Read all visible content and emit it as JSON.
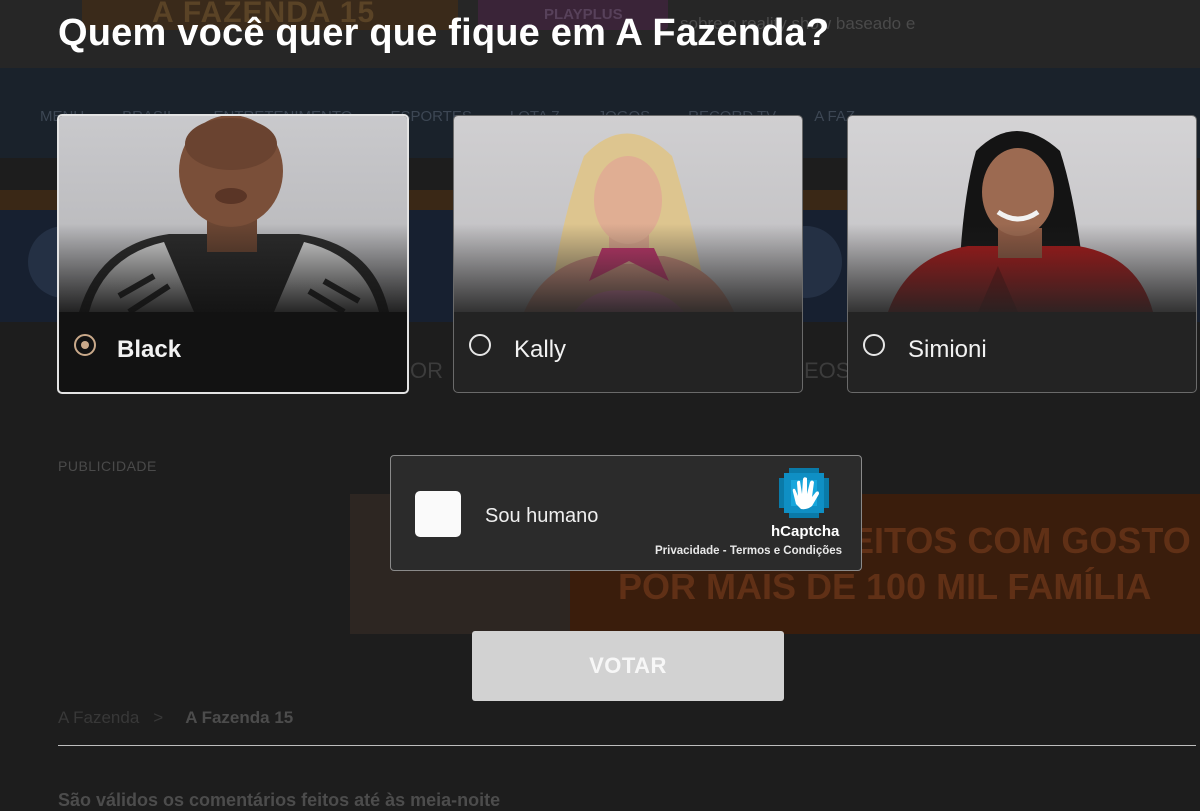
{
  "background": {
    "banner_left": "A FAZENDA 15",
    "banner_right": "PLAYPLUS",
    "top_text": "sobre o reality show baseado e",
    "nav_items": [
      "MENU",
      "BRASIL",
      "ENTRETENIMENTO",
      "ESPORTES",
      "LOTA 7",
      "JOGOS",
      "RECORD TV",
      "A FAZ"
    ],
    "tab_text_left": "OR",
    "tab_text_right": "EOS",
    "publicidade": "PUBLICIDADE",
    "ad_line1": "EITOS COM GOSTO",
    "ad_line2": "POR MAIS DE 100 MIL FAMÍLIA",
    "breadcrumb_parent": "A Fazenda",
    "breadcrumb_sep": ">",
    "breadcrumb_current": "A Fazenda 15",
    "bottom_text": "São válidos os comentários feitos até às meia-noite"
  },
  "poll": {
    "title": "Quem você quer que fique em A Fazenda?",
    "options": [
      {
        "name": "Black",
        "selected": true
      },
      {
        "name": "Kally",
        "selected": false
      },
      {
        "name": "Simioni",
        "selected": false
      }
    ],
    "captcha": {
      "label": "Sou humano",
      "brand": "hCaptcha",
      "privacy": "Privacidade",
      "separator": " - ",
      "terms": "Termos e Condições"
    },
    "vote_button": "VOTAR"
  }
}
